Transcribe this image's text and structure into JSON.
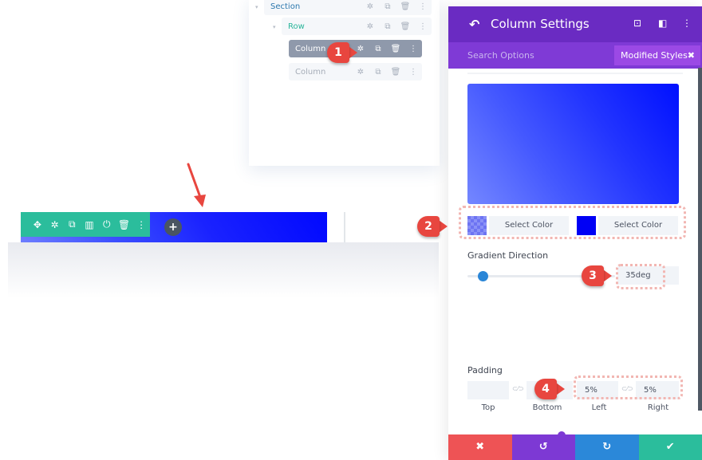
{
  "layers_panel": {
    "items": [
      {
        "label": "Section",
        "type": "section"
      },
      {
        "label": "Row",
        "type": "row"
      },
      {
        "label": "Column",
        "type": "column",
        "state": "active"
      },
      {
        "label": "Column",
        "type": "column"
      }
    ],
    "icons": {
      "caret": "▾",
      "settings": "✲",
      "duplicate": "⧉",
      "delete": "🗑",
      "more": "⋮"
    }
  },
  "canvas": {
    "module_toolbar_icons": [
      "✥",
      "✲",
      "⧉",
      "▥",
      "⏻",
      "🗑",
      "⋮"
    ],
    "add_button": "+"
  },
  "settings_panel": {
    "title": "Column Settings",
    "back_icon": "↶",
    "header_icons": [
      "⊡",
      "◧",
      "⋮"
    ],
    "search_placeholder": "Search Options",
    "filter_tag": "Modified Styles",
    "filter_tag_close": "✖",
    "gradient": {
      "start_color": "#6d74f2",
      "end_color": "#0000f5",
      "start_label": "Select Color",
      "end_label": "Select Color",
      "direction_label": "Gradient Direction",
      "direction_value": "35deg",
      "direction_fraction": 0.1
    },
    "padding": {
      "label": "Padding",
      "link_icon": "⊂⁄⊃",
      "top": {
        "label": "Top",
        "value": ""
      },
      "bottom": {
        "label": "Bottom",
        "value": ""
      },
      "left": {
        "label": "Left",
        "value": "5%"
      },
      "right": {
        "label": "Right",
        "value": "5%"
      }
    },
    "footer": {
      "cancel": "✖",
      "undo": "↺",
      "redo": "↻",
      "save": "✔"
    }
  },
  "callouts": [
    "1",
    "2",
    "3",
    "4"
  ],
  "colors": {
    "header_purple": "#6a2bc2",
    "subbar_purple": "#7f3ad6",
    "accent_green": "#2bbd9c",
    "cancel_red": "#ee5355",
    "redo_blue": "#2b88d9",
    "callout_red": "#e8463f"
  }
}
